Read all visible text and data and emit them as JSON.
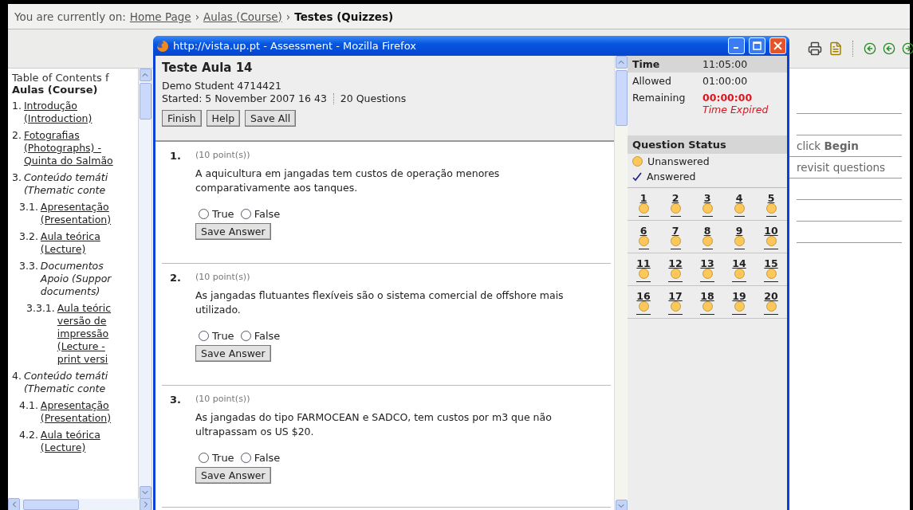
{
  "breadcrumb": {
    "prefix": "You are currently on:",
    "separator": "›",
    "links": [
      "Home Page",
      "Aulas (Course)"
    ],
    "current": "Testes (Quizzes)"
  },
  "sidebar": {
    "heading": "Table of Contents f",
    "course": "Aulas (Course)",
    "items": [
      {
        "number": "1.",
        "kind": "link",
        "lines": [
          "Introdução",
          "(Introduction)"
        ]
      },
      {
        "number": "2.",
        "kind": "link",
        "lines": [
          "Fotografias",
          "(Photographs) -",
          "Quinta do Salmão"
        ]
      },
      {
        "number": "3.",
        "kind": "heading",
        "lines": [
          "Conteúdo temáti",
          "(Thematic conte"
        ],
        "children": [
          {
            "number": "3.1.",
            "kind": "link",
            "lines": [
              "Apresentação",
              "(Presentation)"
            ]
          },
          {
            "number": "3.2.",
            "kind": "link",
            "lines": [
              "Aula teórica",
              "(Lecture)"
            ]
          },
          {
            "number": "3.3.",
            "kind": "heading",
            "lines": [
              "Documentos",
              "Apoio (Suppor",
              "documents)"
            ],
            "children": [
              {
                "number": "3.3.1.",
                "kind": "link",
                "lines": [
                  "Aula teóric",
                  "versão de",
                  "impressão",
                  "(Lecture -",
                  "print versi"
                ]
              }
            ]
          }
        ]
      },
      {
        "number": "4.",
        "kind": "heading",
        "lines": [
          "Conteúdo temáti",
          "(Thematic conte"
        ],
        "children": [
          {
            "number": "4.1.",
            "kind": "link",
            "lines": [
              "Apresentação",
              "(Presentation)"
            ]
          },
          {
            "number": "4.2.",
            "kind": "link",
            "lines": [
              "Aula teórica",
              "(Lecture)"
            ]
          }
        ]
      }
    ]
  },
  "background": {
    "instructions": [
      "click **Begin**",
      "revisit questions"
    ]
  },
  "window": {
    "title": "http://vista.up.pt - Assessment - Mozilla Firefox"
  },
  "quiz": {
    "title": "Teste Aula 14",
    "student": "Demo Student 4714421",
    "started": "Started: 5 November 2007 16 43",
    "count": "20 Questions",
    "buttons": [
      "Finish",
      "Help",
      "Save All"
    ]
  },
  "questions": [
    {
      "number": "1.",
      "points": "(10 point(s))",
      "text": "A aquicultura em jangadas tem custos de operação menores comparativamente aos tanques.",
      "options": [
        {
          "label": "True",
          "selected": false
        },
        {
          "label": "False",
          "selected": false
        }
      ],
      "button": "Save Answer"
    },
    {
      "number": "2.",
      "points": "(10 point(s))",
      "text": "As jangadas flutuantes flexíveis são o sistema comercial de offshore mais utilizado.",
      "options": [
        {
          "label": "True",
          "selected": false
        },
        {
          "label": "False",
          "selected": false
        }
      ],
      "button": "Save Answer"
    },
    {
      "number": "3.",
      "points": "(10 point(s))",
      "text": "As jangadas do tipo FARMOCEAN e SADCO, tem custos por m3 que não ultrapassam os US $20.",
      "options": [
        {
          "label": "True",
          "selected": false
        },
        {
          "label": "False",
          "selected": false
        }
      ],
      "button": "Save Answer"
    }
  ],
  "timer": [
    {
      "label": "Time",
      "value": "11:05:00",
      "kind": "header"
    },
    {
      "label": "Allowed",
      "value": "01:00:00",
      "kind": "plain"
    },
    {
      "label": "Remaining",
      "value": "00:00:00",
      "kind": "alert",
      "note": "Time Expired"
    }
  ],
  "status": {
    "title": "Question Status",
    "legend": [
      {
        "label": "Unanswered",
        "answered": false
      },
      {
        "label": "Answered",
        "answered": true
      }
    ],
    "questions": [
      {
        "label": "1",
        "answered": false
      },
      {
        "label": "2",
        "answered": false
      },
      {
        "label": "3",
        "answered": false
      },
      {
        "label": "4",
        "answered": false
      },
      {
        "label": "5",
        "answered": false
      },
      {
        "label": "6",
        "answered": false
      },
      {
        "label": "7",
        "answered": false
      },
      {
        "label": "8",
        "answered": false
      },
      {
        "label": "9",
        "answered": false
      },
      {
        "label": "10",
        "answered": false
      },
      {
        "label": "11",
        "answered": false
      },
      {
        "label": "12",
        "answered": false
      },
      {
        "label": "13",
        "answered": false
      },
      {
        "label": "14",
        "answered": false
      },
      {
        "label": "15",
        "answered": false
      },
      {
        "label": "16",
        "answered": false
      },
      {
        "label": "17",
        "answered": false
      },
      {
        "label": "18",
        "answered": false
      },
      {
        "label": "19",
        "answered": false
      },
      {
        "label": "20",
        "answered": false
      }
    ]
  }
}
